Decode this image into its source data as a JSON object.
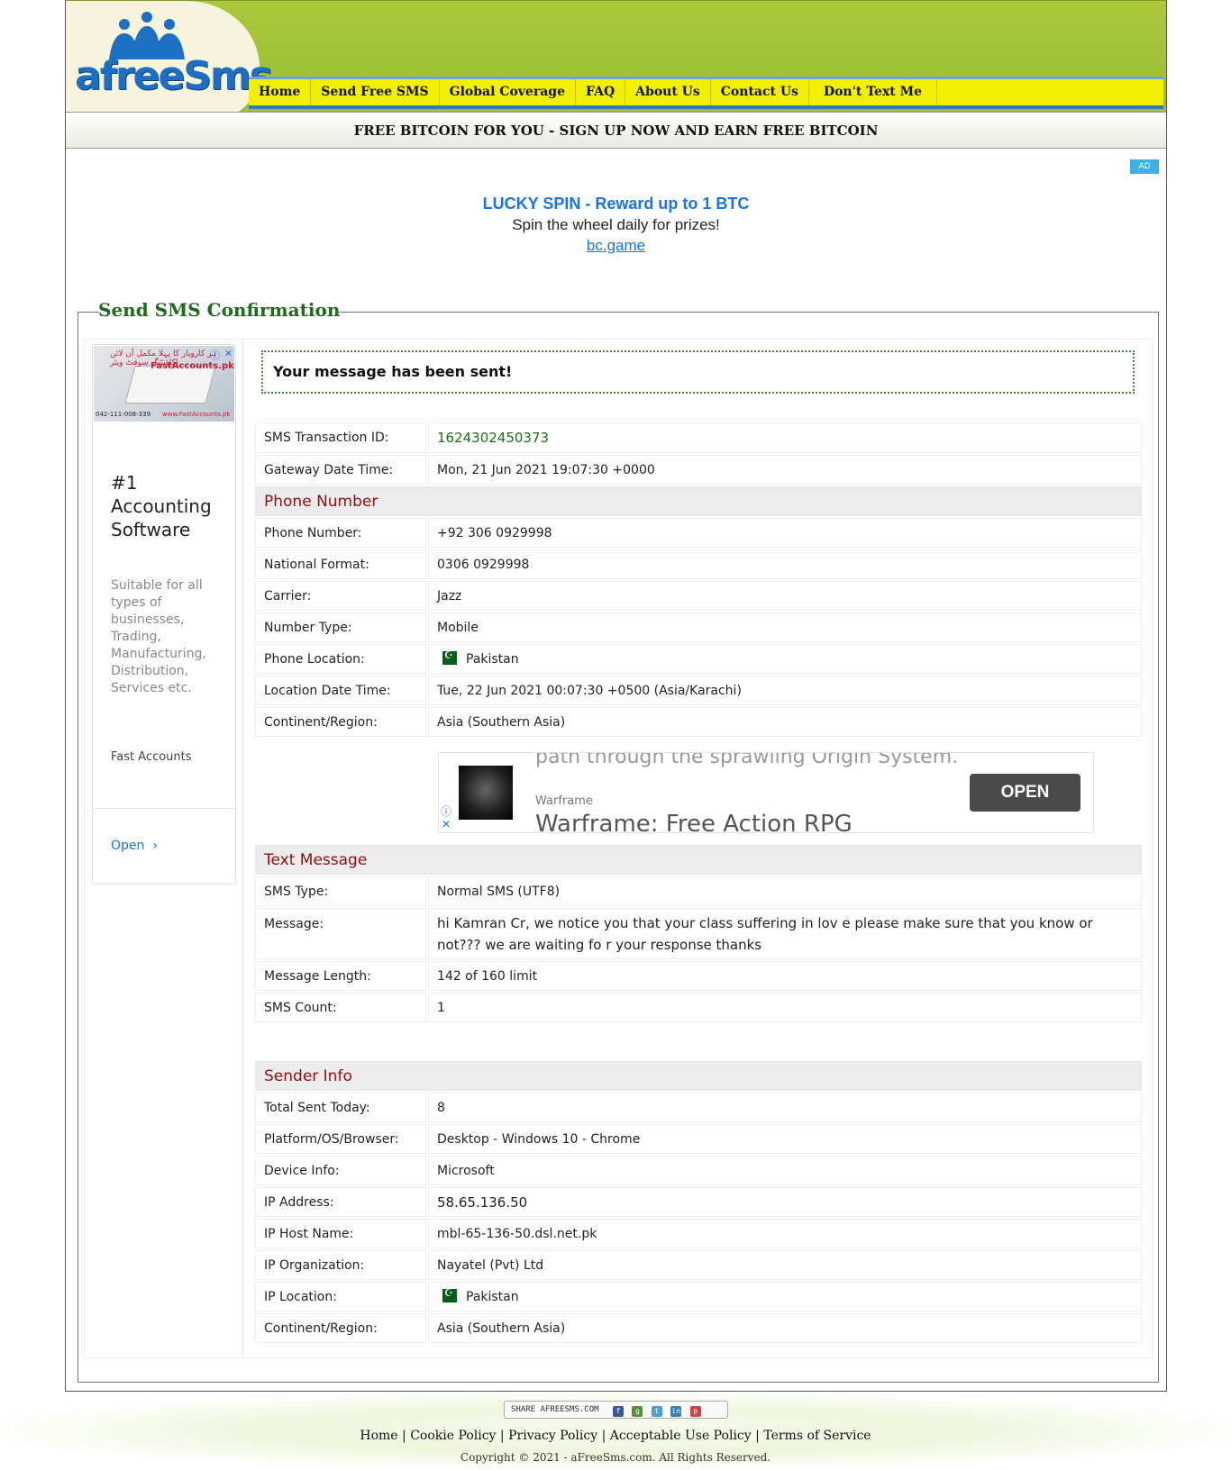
{
  "logo": {
    "text": "afreeSms"
  },
  "nav": [
    "Home",
    "Send Free SMS",
    "Global Coverage",
    "FAQ",
    "About Us",
    "Contact Us",
    "Don't Text Me"
  ],
  "promo": "FREE BITCOIN FOR YOU - SIGN UP NOW AND EARN FREE BITCOIN",
  "ad_badge": "AD",
  "btc_ad": {
    "title": "LUCKY SPIN - Reward up to 1 BTC",
    "subtitle": "Spin the wheel daily for prizes!",
    "link": "bc.game"
  },
  "legend": "Send SMS Confirmation",
  "side_ad": {
    "urdu": "ہر کاروبار کا پہلا مکمل آن لائن اکاؤنٹنگ سوفٹ ویئر",
    "brand_img": "FastAccounts.pk",
    "phone": "042-111-008-339",
    "www": "www.FastAccounts.pk",
    "headline": "#1 Accounting Software",
    "desc": "Suitable for all types of businesses, Trading, Manufacturing, Distribution, Services etc.",
    "brand": "Fast Accounts",
    "open": "Open"
  },
  "status": "Your message has been sent!",
  "transaction": [
    {
      "k": "SMS Transaction ID:",
      "v": "1624302450373"
    },
    {
      "k": "Gateway Date Time:",
      "v": "Mon, 21 Jun 2021 19:07:30 +0000"
    }
  ],
  "phone_section": {
    "title": "Phone Number",
    "rows": [
      {
        "k": "Phone Number:",
        "v": "+92 306 0929998"
      },
      {
        "k": "National Format:",
        "v": "0306 0929998"
      },
      {
        "k": "Carrier:",
        "v": "Jazz"
      },
      {
        "k": "Number Type:",
        "v": "Mobile"
      },
      {
        "k": "Phone Location:",
        "v": "Pakistan"
      },
      {
        "k": "Location Date Time:",
        "v": "Tue, 22 Jun 2021 00:07:30 +0500 (Asia/Karachi)"
      },
      {
        "k": "Continent/Region:",
        "v": "Asia (Southern Asia)"
      }
    ]
  },
  "warframe_ad": {
    "clipped": "path through the sprawling Origin System.",
    "brand": "Warframe",
    "title": "Warframe: Free Action RPG",
    "open": "OPEN"
  },
  "text_section": {
    "title": "Text Message",
    "rows": [
      {
        "k": "SMS Type:",
        "v": "Normal SMS (UTF8)"
      },
      {
        "k": "Message:",
        "v": "hi Kamran Cr, we notice you that your class suffering in lov e please make sure that you know or not??? we are waiting fo r your response thanks"
      },
      {
        "k": "Message Length:",
        "v": "142 of 160 limit"
      },
      {
        "k": "SMS Count:",
        "v": "1"
      }
    ]
  },
  "sender_section": {
    "title": "Sender Info",
    "rows": [
      {
        "k": "Total Sent Today:",
        "v": "8"
      },
      {
        "k": "Platform/OS/Browser:",
        "v": "Desktop - Windows 10 - Chrome"
      },
      {
        "k": "Device Info:",
        "v": "Microsoft"
      },
      {
        "k": "IP Address:",
        "v": "58.65.136.50"
      },
      {
        "k": "IP Host Name:",
        "v": "mbl-65-136-50.dsl.net.pk"
      },
      {
        "k": "IP Organization:",
        "v": "Nayatel (Pvt) Ltd"
      },
      {
        "k": "IP Location:",
        "v": "Pakistan"
      },
      {
        "k": "Continent/Region:",
        "v": "Asia (Southern Asia)"
      }
    ]
  },
  "share": {
    "label": "SHARE AFREESMS.COM"
  },
  "footer": {
    "links": [
      "Home",
      "Cookie Policy",
      "Privacy Policy",
      "Acceptable Use Policy",
      "Terms of Service"
    ],
    "copyright": "Copyright © 2021 - aFreeSms.com. All Rights Reserved."
  },
  "colors": {
    "header_green": "#a9c83c",
    "nav_yellow": "#f1f000",
    "nav_blue": "#2f78bd",
    "legend_green": "#1e6b1e",
    "section_red": "#8b1010",
    "link_blue": "#1a73e8"
  }
}
